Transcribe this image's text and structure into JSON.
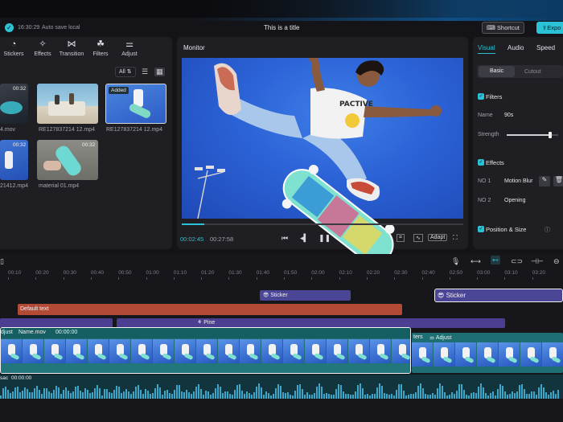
{
  "top": {
    "time": "16:30:29",
    "save_status": "Auto save local",
    "title": "This is a title",
    "shortcut": "Shortcut",
    "export": "Expo"
  },
  "toolbar": {
    "tools": [
      {
        "label": "Stickers",
        "icon": "stickers-icon"
      },
      {
        "label": "Effects",
        "icon": "effects-icon"
      },
      {
        "label": "Transition",
        "icon": "transition-icon"
      },
      {
        "label": "Filters",
        "icon": "filters-icon"
      },
      {
        "label": "Adjust",
        "icon": "adjust-icon"
      }
    ],
    "filter_all": "All"
  },
  "media": [
    {
      "name": "4.mov",
      "duration": "00:32",
      "added": ""
    },
    {
      "name": "RE127837214 12.mp4",
      "duration": "",
      "added": ""
    },
    {
      "name": "RE127837214 12.mp4",
      "duration": "",
      "added": "Added"
    },
    {
      "name": "21412.mp4",
      "duration": "00:32",
      "added": ""
    },
    {
      "name": "material 01.mp4",
      "duration": "",
      "added": ""
    }
  ],
  "monitor": {
    "label": "Monitor",
    "current_time": "00:02:45",
    "total_time": "00:27:58",
    "adapt": "Adapt",
    "progress": 0.08
  },
  "inspector": {
    "tabs": [
      "Visual",
      "Audio",
      "Speed"
    ],
    "active_tab": "Visual",
    "subtabs": [
      "Basic",
      "Cutout"
    ],
    "filters_heading": "Filters",
    "name_label": "Name",
    "name_value": "90s",
    "strength_label": "Strength",
    "strength_value": 0.85,
    "effects_heading": "Effects",
    "effects": [
      {
        "slot": "NO 1",
        "name": "Motion Blur"
      },
      {
        "slot": "NO 2",
        "name": "Opening"
      }
    ],
    "position_heading": "Position & Size"
  },
  "timeline": {
    "ruler": [
      "00:10",
      "00:20",
      "00:30",
      "00:40",
      "00:50",
      "01:00",
      "01:10",
      "01:20",
      "01:30",
      "01:40",
      "01:50",
      "02:00",
      "02:10",
      "02:20",
      "02:30",
      "02:40",
      "02:50",
      "03:00",
      "03:10",
      "03:20"
    ],
    "sticker_clip": "Sticker",
    "sticker_clip_2": "Sticker",
    "text_clip": "Default text",
    "pine_clip": "Pine",
    "main_clip": {
      "adjust": "djust",
      "name": "Name.mov",
      "time": "00:00:00"
    },
    "second_clip": {
      "label": "ters",
      "adjust": "Adjust"
    },
    "audio_clip": {
      "label": "sac",
      "time": "00:00:00"
    }
  },
  "colors": {
    "accent": "#29c2d6",
    "sticker": "#4a4594",
    "text": "#b24a36",
    "pine": "#4c3f91",
    "video": "#1d6f73"
  }
}
